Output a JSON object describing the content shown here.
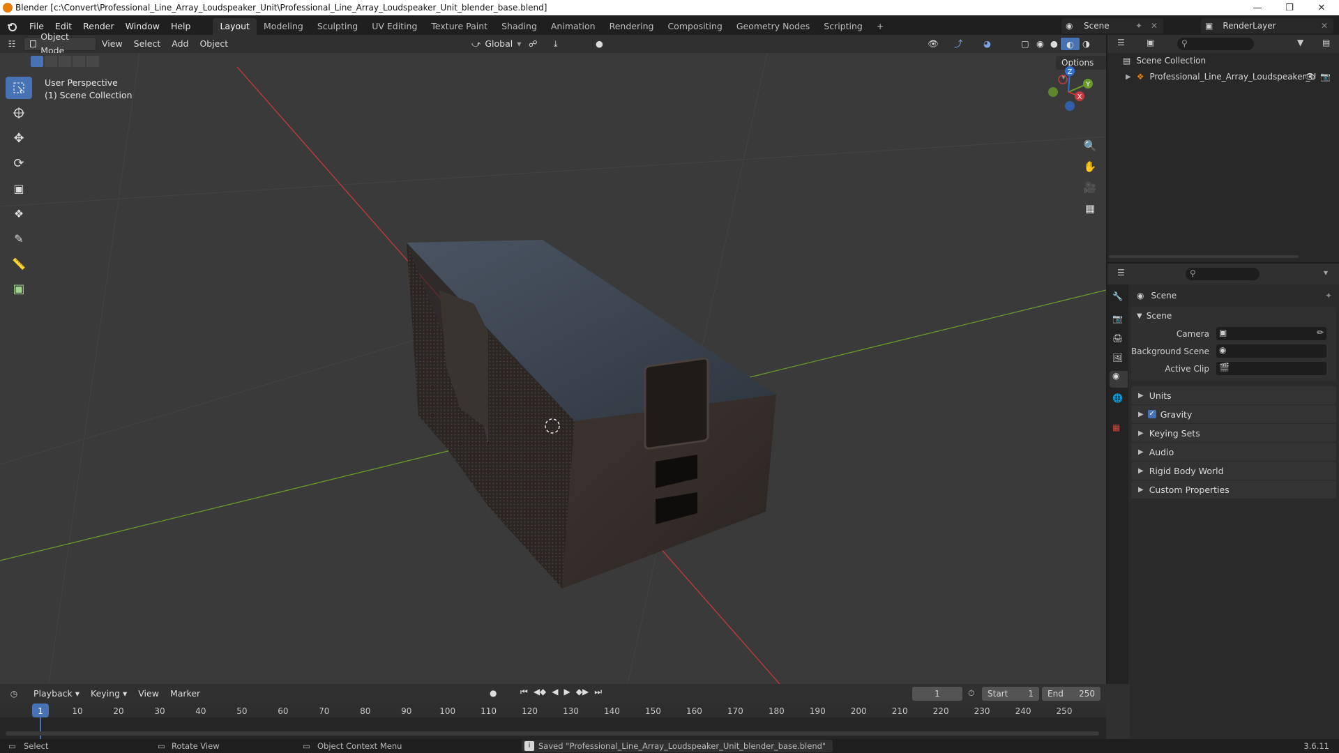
{
  "window": {
    "title": "Blender [c:\\Convert\\Professional_Line_Array_Loudspeaker_Unit\\Professional_Line_Array_Loudspeaker_Unit_blender_base.blend]"
  },
  "menus": [
    "File",
    "Edit",
    "Render",
    "Window",
    "Help"
  ],
  "workspaces": [
    "Layout",
    "Modeling",
    "Sculpting",
    "UV Editing",
    "Texture Paint",
    "Shading",
    "Animation",
    "Rendering",
    "Compositing",
    "Geometry Nodes",
    "Scripting"
  ],
  "active_workspace": "Layout",
  "scene_selector": "Scene",
  "renderlayer_selector": "RenderLayer",
  "viewport_header": {
    "mode": "Object Mode",
    "menus": [
      "View",
      "Select",
      "Add",
      "Object"
    ],
    "transform_orientation": "Global",
    "options": "Options"
  },
  "viewport": {
    "perspective_label": "User Perspective",
    "collection_label": "(1) Scene Collection",
    "gizmo_axes": {
      "x": "X",
      "y": "Y",
      "z": "Z"
    }
  },
  "outliner": {
    "root": "Scene Collection",
    "items": [
      {
        "label": "Professional_Line_Array_Loudspeaker_U"
      }
    ]
  },
  "properties": {
    "context_title": "Scene",
    "panel_scene": "Scene",
    "fields": {
      "camera_label": "Camera",
      "background_scene_label": "Background Scene",
      "active_clip_label": "Active Clip"
    },
    "panels": [
      {
        "label": "Units",
        "checkbox": false
      },
      {
        "label": "Gravity",
        "checkbox": true
      },
      {
        "label": "Keying Sets",
        "checkbox": false
      },
      {
        "label": "Audio",
        "checkbox": false
      },
      {
        "label": "Rigid Body World",
        "checkbox": false
      },
      {
        "label": "Custom Properties",
        "checkbox": false
      }
    ]
  },
  "timeline": {
    "menus": [
      "Playback",
      "Keying",
      "View",
      "Marker"
    ],
    "current_frame": "1",
    "start_label": "Start",
    "start_value": "1",
    "end_label": "End",
    "end_value": "250",
    "ticks": [
      "1",
      "10",
      "20",
      "30",
      "40",
      "50",
      "60",
      "70",
      "80",
      "90",
      "100",
      "110",
      "120",
      "130",
      "140",
      "150",
      "160",
      "170",
      "180",
      "190",
      "200",
      "210",
      "220",
      "230",
      "240",
      "250"
    ]
  },
  "statusbar": {
    "select": "Select",
    "rotate_view": "Rotate View",
    "context_menu": "Object Context Menu",
    "message": "Saved \"Professional_Line_Array_Loudspeaker_Unit_blender_base.blend\"",
    "version": "3.6.11"
  },
  "colors": {
    "accent": "#4772b3",
    "x_axis": "#c8383e",
    "y_axis": "#6a9a2a",
    "z_axis": "#2f6fd6",
    "blender_orange": "#e87d0d"
  }
}
